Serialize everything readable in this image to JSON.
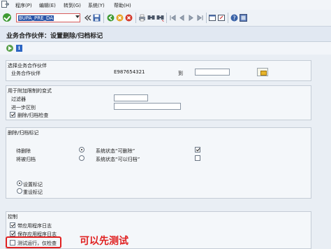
{
  "menu": {
    "items": [
      "程序(P)",
      "编辑(E)",
      "转到(G)",
      "系统(Y)",
      "帮助(H)"
    ]
  },
  "toolbar": {
    "command_value": "BUPA_PRE_DA"
  },
  "title": "业务合作伙伴：设置删除/归档标记",
  "selection_group": {
    "title": "选择业务合作伙伴",
    "partner_label": "业务合作伙伴",
    "partner_value": "E987654321",
    "to_label": "到",
    "to_value": ""
  },
  "restriction_group": {
    "title": "用于附加限制的变式",
    "filter_label": "过滤器",
    "further_label": "进一步区别",
    "delete_check_label": "删除/归档检查",
    "delete_check_checked": true
  },
  "flag_group": {
    "title": "删除/归档标记",
    "pending_delete_label": "待删除",
    "archived_label": "将被归档",
    "status_delete_label": "系统状态“可删除”",
    "status_archive_label": "系统状态“可以归档”",
    "status_delete_checked": true,
    "status_archive_checked": false,
    "set_flag_label": "设置标记",
    "reset_flag_label": "重设标记"
  },
  "control_group": {
    "title": "控制",
    "with_log_label": "带应用程序日志",
    "save_log_label": "保存应用程序日志",
    "test_run_label": "测试运行，仅检查",
    "with_log_checked": true,
    "save_log_checked": true,
    "test_run_checked": false
  },
  "annotation": "可以先测试",
  "colors": {
    "accent": "#2b56a8",
    "annotation": "#e02020",
    "ok_green": "#3f9b34"
  }
}
